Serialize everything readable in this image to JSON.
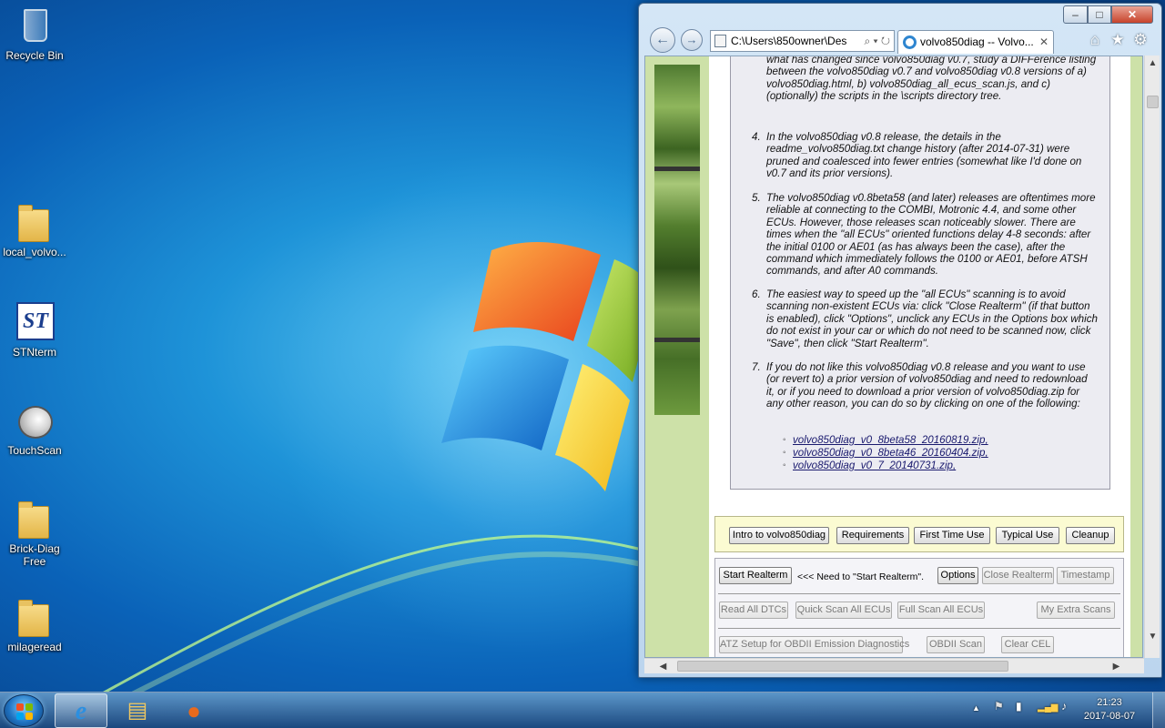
{
  "desktop": {
    "icons": [
      {
        "id": "recycle-bin",
        "label": "Recycle Bin"
      },
      {
        "id": "local-volvo",
        "label": "local_volvo..."
      },
      {
        "id": "stnterm",
        "label": "STNterm",
        "glyph": "ST"
      },
      {
        "id": "touchscan",
        "label": "TouchScan"
      },
      {
        "id": "brick-diag",
        "label": "Brick-Diag Free"
      },
      {
        "id": "milageread",
        "label": "milageread"
      }
    ]
  },
  "browser": {
    "window_controls": {
      "minimize": "–",
      "maximize": "□",
      "close": "✕"
    },
    "address": "C:\\Users\\850owner\\Des",
    "address_tools": "⌕ ▾ ↻",
    "tab_title": "volvo850diag -- Volvo...",
    "tab_close": "✕",
    "back": "←",
    "forward": "→",
    "toolbar_icons": {
      "home": "⌂",
      "favorites": "★",
      "tools": "⚙"
    }
  },
  "content": {
    "item3_tail": "what has changed since volvo850diag v0.7, study a DIFFerence listing between the volvo850diag v0.7 and volvo850diag v0.8 versions of a) volvo850diag.html, b) volvo850diag_all_ecus_scan.js, and c) (optionally) the scripts in the \\scripts directory tree.",
    "items": [
      {
        "num": "4.",
        "text": "In the volvo850diag v0.8 release, the details in the readme_volvo850diag.txt change history (after 2014-07-31) were pruned and coalesced into fewer entries (somewhat like I'd done on v0.7 and its prior versions)."
      },
      {
        "num": "5.",
        "text": "The volvo850diag v0.8beta58 (and later) releases are oftentimes more reliable at connecting to the COMBI, Motronic 4.4, and some other ECUs.  However, those releases scan noticeably slower.  There are times when the \"all ECUs\" oriented functions delay 4-8 seconds: after the initial 0100 or AE01 (as has always been the case), after the command which immediately follows the 0100 or AE01, before ATSH commands, and after A0 commands."
      },
      {
        "num": "6.",
        "text": "The easiest way to speed up the \"all ECUs\" scanning is to avoid scanning non-existent ECUs via: click \"Close Realterm\" (if that button is enabled), click \"Options\", unclick any ECUs in the Options box which do not exist in your car or which do not need to be scanned now, click \"Save\", then click \"Start Realterm\"."
      },
      {
        "num": "7.",
        "text": "If you do not like this volvo850diag v0.8 release and you want to use (or revert to) a prior version of volvo850diag and need to redownload it, or if you need to download a prior version of volvo850diag.zip for any other reason, you can do so by clicking on one of the following:"
      }
    ],
    "bullet": "◦",
    "links": [
      "volvo850diag_v0_8beta58_20160819.zip,",
      "volvo850diag_v0_8beta46_20160404.zip,",
      "volvo850diag_v0_7_20140731.zip,"
    ]
  },
  "navbar": {
    "intro": "Intro to volvo850diag",
    "requirements": "Requirements",
    "first_time": "First Time Use",
    "typical": "Typical Use",
    "cleanup": "Cleanup"
  },
  "panel": {
    "start_realterm": "Start Realterm",
    "note": "<<< Need to \"Start Realterm\".",
    "options": "Options",
    "close_realterm": "Close Realterm",
    "timestamp": "Timestamp",
    "read_dtcs": "Read All DTCs",
    "quick_scan": "Quick Scan All ECUs",
    "full_scan": "Full Scan All ECUs",
    "extra_scans": "My Extra Scans",
    "atz_setup": "ATZ Setup for OBDII Emission Diagnostics",
    "obdii_scan": "OBDII Scan",
    "clear_cel": "Clear CEL"
  },
  "scroll": {
    "up": "▲",
    "down": "▼",
    "left": "◀",
    "right": "▶"
  },
  "taskbar": {
    "ie_glyph": "e",
    "explorer_glyph": "▤",
    "firefox_glyph": "●",
    "tray": {
      "arrow": "▲",
      "flag": "⚑",
      "power": "▮",
      "signal": "▂▄▆",
      "volume": "♪"
    },
    "time": "21:23",
    "date": "2017-08-07"
  },
  "colors": {
    "sidebar_green": "#cde1a8",
    "navbar_yellow": "#fbfbd2",
    "link": "#1a1a6e"
  }
}
